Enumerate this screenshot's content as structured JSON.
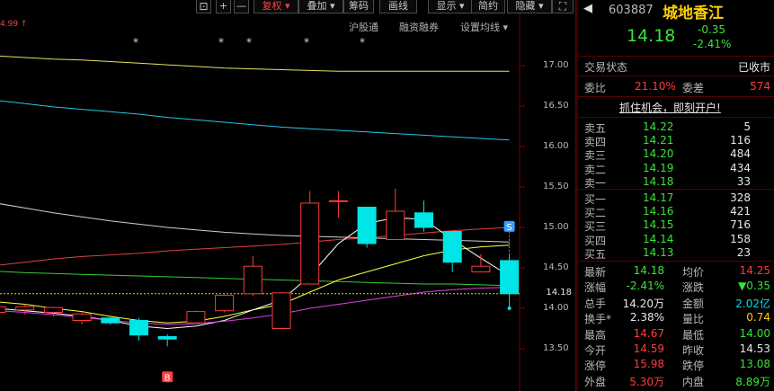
{
  "toolbar": {
    "items": [
      {
        "label": "⊡",
        "name": "layout-icon-button"
      },
      {
        "label": "+",
        "name": "zoom-in-button"
      },
      {
        "label": "—",
        "name": "zoom-out-button"
      },
      {
        "label": "复权",
        "name": "adjust-dropdown"
      },
      {
        "label": "叠加",
        "name": "overlay-dropdown"
      },
      {
        "label": "筹码",
        "name": "chips-button"
      },
      {
        "label": "画线",
        "name": "draw-line-button"
      },
      {
        "label": "显示",
        "name": "display-dropdown"
      },
      {
        "label": "简约",
        "name": "simple-button"
      },
      {
        "label": "隐藏",
        "name": "hide-dropdown"
      },
      {
        "label": "⛶",
        "name": "fullscreen-icon-button"
      }
    ],
    "dropdown_arrow": "▾"
  },
  "subbar": {
    "max_price_label": "4.99",
    "max_arrow": "↑",
    "links": [
      "沪股通",
      "融资融券",
      "设置均线"
    ],
    "dropdown_arrow": "▾",
    "star": "*"
  },
  "axis": {
    "ticks": [
      "17.00",
      "16.50",
      "16.00",
      "15.50",
      "15.00",
      "14.50",
      "14.00",
      "13.50"
    ],
    "current_price_tag": "14.18"
  },
  "markers": {
    "buy": "B",
    "sell": "S"
  },
  "chart_data": {
    "type": "candlestick",
    "ylim": [
      13.3,
      17.3
    ],
    "candles": [
      {
        "o": 13.95,
        "h": 14.05,
        "l": 13.55,
        "c": 14.02
      },
      {
        "o": 13.98,
        "h": 14.05,
        "l": 13.92,
        "c": 14.02
      },
      {
        "o": 13.95,
        "h": 14.02,
        "l": 13.9,
        "c": 14.01
      },
      {
        "o": 13.85,
        "h": 13.95,
        "l": 13.8,
        "c": 13.93
      },
      {
        "o": 13.88,
        "h": 13.9,
        "l": 13.8,
        "c": 13.82
      },
      {
        "o": 13.85,
        "h": 13.88,
        "l": 13.6,
        "c": 13.67
      },
      {
        "o": 13.65,
        "h": 13.68,
        "l": 13.53,
        "c": 13.62
      },
      {
        "o": 13.82,
        "h": 13.97,
        "l": 13.82,
        "c": 13.96
      },
      {
        "o": 13.97,
        "h": 14.17,
        "l": 13.95,
        "c": 14.16
      },
      {
        "o": 14.18,
        "h": 14.65,
        "l": 14.15,
        "c": 14.52
      },
      {
        "o": 13.75,
        "h": 14.2,
        "l": 13.75,
        "c": 14.19
      },
      {
        "o": 14.3,
        "h": 15.45,
        "l": 14.3,
        "c": 15.3
      },
      {
        "o": 15.33,
        "h": 15.45,
        "l": 15.12,
        "c": 15.33
      },
      {
        "o": 15.25,
        "h": 15.25,
        "l": 14.75,
        "c": 14.8
      },
      {
        "o": 14.85,
        "h": 15.48,
        "l": 14.85,
        "c": 15.2
      },
      {
        "o": 15.18,
        "h": 15.33,
        "l": 14.95,
        "c": 15.0
      },
      {
        "o": 14.95,
        "h": 14.95,
        "l": 14.45,
        "c": 14.57
      },
      {
        "o": 14.45,
        "h": 14.67,
        "l": 14.45,
        "c": 14.52
      },
      {
        "o": 14.59,
        "h": 14.67,
        "l": 14.0,
        "c": 14.18
      }
    ],
    "ma_lines": [
      {
        "color": "#e8e060",
        "points": [
          17.12,
          17.1,
          17.08,
          17.07,
          17.05,
          17.03,
          17.01,
          16.99,
          16.97,
          16.96,
          16.95,
          16.94,
          16.93,
          16.93,
          16.93,
          16.93,
          16.93,
          16.93,
          16.93
        ]
      },
      {
        "color": "#20c8e8",
        "points": [
          16.57,
          16.53,
          16.49,
          16.46,
          16.43,
          16.4,
          16.36,
          16.33,
          16.3,
          16.27,
          16.24,
          16.22,
          16.2,
          16.18,
          16.16,
          16.14,
          16.12,
          16.1,
          16.08
        ]
      },
      {
        "color": "#d0d0d0",
        "points": [
          15.3,
          15.24,
          15.18,
          15.13,
          15.08,
          15.04,
          15.0,
          14.97,
          14.94,
          14.92,
          14.9,
          14.89,
          14.88,
          14.87,
          14.86,
          14.85,
          14.84,
          14.83,
          14.82
        ]
      },
      {
        "color": "#e04040",
        "points": [
          14.53,
          14.57,
          14.61,
          14.64,
          14.66,
          14.68,
          14.71,
          14.73,
          14.75,
          14.77,
          14.79,
          14.82,
          14.85,
          14.87,
          14.9,
          14.93,
          14.96,
          14.98,
          15.0
        ]
      },
      {
        "color": "#30d030",
        "points": [
          14.46,
          14.44,
          14.43,
          14.42,
          14.41,
          14.4,
          14.39,
          14.38,
          14.37,
          14.36,
          14.35,
          14.34,
          14.33,
          14.32,
          14.31,
          14.3,
          14.3,
          14.29,
          14.28
        ]
      },
      {
        "color": "#ffff40",
        "points": [
          14.08,
          14.05,
          14.0,
          13.96,
          13.9,
          13.85,
          13.82,
          13.84,
          13.9,
          13.98,
          14.05,
          14.2,
          14.35,
          14.45,
          14.55,
          14.65,
          14.72,
          14.76,
          14.78
        ]
      },
      {
        "color": "#ffffff",
        "points": [
          14.0,
          13.97,
          13.94,
          13.9,
          13.85,
          13.78,
          13.75,
          13.78,
          13.85,
          13.98,
          14.1,
          14.4,
          14.8,
          15.05,
          15.12,
          15.1,
          14.85,
          14.62,
          14.4
        ]
      },
      {
        "color": "#e040e0",
        "points": [
          13.97,
          13.95,
          13.92,
          13.89,
          13.85,
          13.82,
          13.8,
          13.81,
          13.84,
          13.88,
          13.93,
          14.0,
          14.05,
          14.1,
          14.15,
          14.2,
          14.23,
          14.25,
          14.26
        ]
      }
    ],
    "current_price": 14.18,
    "buy_index": 6,
    "sell_index": 18
  },
  "panel": {
    "code": "603887",
    "name": "城地香江",
    "price": "14.18",
    "change": "-0.35",
    "change_pct": "-2.41%",
    "status_label": "交易状态",
    "status_value": "已收市",
    "weibi_label": "委比",
    "weibi_value": "21.10%",
    "weicha_label": "委差",
    "weicha_value": "574",
    "promo": "抓住机会，即刻开户!",
    "sells": [
      {
        "label": "卖五",
        "price": "14.22",
        "vol": "5"
      },
      {
        "label": "卖四",
        "price": "14.21",
        "vol": "116"
      },
      {
        "label": "卖三",
        "price": "14.20",
        "vol": "484"
      },
      {
        "label": "卖二",
        "price": "14.19",
        "vol": "434"
      },
      {
        "label": "卖一",
        "price": "14.18",
        "vol": "33"
      }
    ],
    "buys": [
      {
        "label": "买一",
        "price": "14.17",
        "vol": "328"
      },
      {
        "label": "买二",
        "price": "14.16",
        "vol": "421"
      },
      {
        "label": "买三",
        "price": "14.15",
        "vol": "716"
      },
      {
        "label": "买四",
        "price": "14.14",
        "vol": "158"
      },
      {
        "label": "买五",
        "price": "14.13",
        "vol": "23"
      }
    ],
    "stats": [
      {
        "l1": "最新",
        "v1": "14.18",
        "c1": "green",
        "l2": "均价",
        "v2": "14.25",
        "c2": "red"
      },
      {
        "l1": "涨幅",
        "v1": "-2.41%",
        "c1": "green",
        "l2": "涨跌",
        "v2": "▼0.35",
        "c2": "green"
      },
      {
        "l1": "总手",
        "v1": "14.20万",
        "c1": "white",
        "l2": "金额",
        "v2": "2.02亿",
        "c2": "cyan"
      },
      {
        "l1": "换手*",
        "v1": "2.38%",
        "c1": "white",
        "l2": "量比",
        "v2": "0.74",
        "c2": "yellow"
      },
      {
        "l1": "最高",
        "v1": "14.67",
        "c1": "red",
        "l2": "最低",
        "v2": "14.00",
        "c2": "green"
      },
      {
        "l1": "今开",
        "v1": "14.59",
        "c1": "red",
        "l2": "昨收",
        "v2": "14.53",
        "c2": "white"
      },
      {
        "l1": "涨停",
        "v1": "15.98",
        "c1": "red",
        "l2": "跌停",
        "v2": "13.08",
        "c2": "green"
      },
      {
        "l1": "外盘",
        "v1": "5.30万",
        "c1": "red",
        "l2": "内盘",
        "v2": "8.89万",
        "c2": "green"
      }
    ]
  },
  "colors": {
    "up": "#ff3b3b",
    "down": "#00e5e5",
    "up_candle_fill": "#000000",
    "down_candle_fill": "#00e5e5",
    "bg": "#000000"
  }
}
